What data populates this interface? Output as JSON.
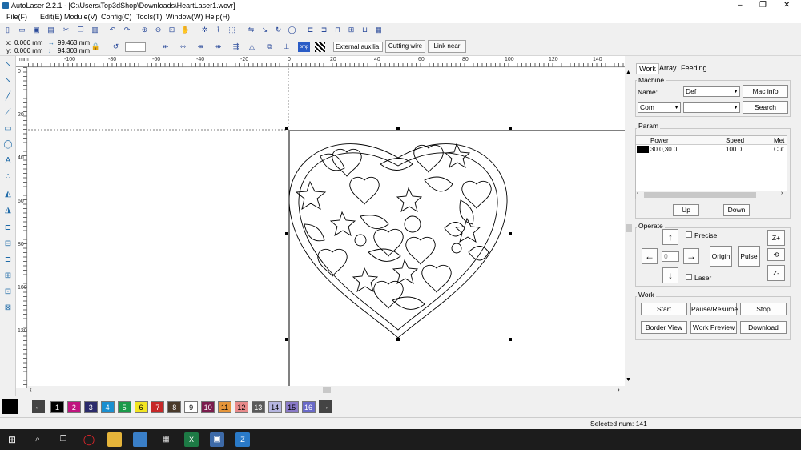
{
  "window": {
    "title": "AutoLaser 2.2.1 - [C:\\Users\\Top3dShop\\Downloads\\HeartLaser1.wcvr]",
    "minimize": "–",
    "maximize": "❐",
    "close": "✕"
  },
  "menu": [
    "File(F)",
    "Edit(E)",
    "Module(V)",
    "Config(C)",
    "Tools(T)",
    "Window(W)",
    "Help(H)"
  ],
  "toolbar2": {
    "x_label": "x:",
    "x_value": "0.000 mm",
    "y_label": "y:",
    "y_value": "0.000 mm",
    "w_value": "99.463 mm",
    "h_value": "94.303 mm",
    "select_value": "External auxilia",
    "cutting_wire": "Cutting wire",
    "link_near": "Link near"
  },
  "ruler": {
    "h_labels": [
      "-100",
      "-80",
      "-60",
      "-40",
      "-20",
      "0",
      "20",
      "40",
      "60",
      "80",
      "100",
      "120",
      "140"
    ],
    "v_labels": [
      "0",
      "20",
      "40",
      "60",
      "80",
      "100",
      "120"
    ],
    "unit": "mm"
  },
  "panel": {
    "tabs": [
      "Work",
      "Array",
      "Feeding"
    ],
    "machine_label": "Machine",
    "name_label": "Name:",
    "name_value": "Def",
    "mac_info": "Mac info",
    "com_value": "Com",
    "port_value": "",
    "search": "Search",
    "param_label": "Param",
    "param_headers": [
      "Power",
      "Speed",
      "Met"
    ],
    "param_row": {
      "power": "30.0,30.0",
      "speed": "100.0",
      "method": "Cut"
    },
    "up": "Up",
    "down": "Down",
    "operate_label": "Operate",
    "precise": "Precise",
    "laser": "Laser",
    "step_value": "0",
    "origin": "Origin",
    "pulse": "Pulse",
    "z_plus": "Z+",
    "z_minus": "Z-",
    "work_label": "Work",
    "start": "Start",
    "pause_resume": "Pause/Resume",
    "stop": "Stop",
    "border_view": "Border View",
    "work_preview": "Work Preview",
    "download": "Download"
  },
  "layers": [
    {
      "label": "1",
      "color": "#000000",
      "text": "#ffffff"
    },
    {
      "label": "2",
      "color": "#c0157f",
      "text": "#ffffff"
    },
    {
      "label": "3",
      "color": "#2b2b6b",
      "text": "#ffffff"
    },
    {
      "label": "4",
      "color": "#1a8fd0",
      "text": "#ffffff"
    },
    {
      "label": "5",
      "color": "#1b9a4a",
      "text": "#ffffff"
    },
    {
      "label": "6",
      "color": "#f2e521",
      "text": "#000000"
    },
    {
      "label": "7",
      "color": "#c62828",
      "text": "#ffffff"
    },
    {
      "label": "8",
      "color": "#4a3a2a",
      "text": "#ffffff"
    },
    {
      "label": "9",
      "color": "#ffffff",
      "text": "#000000"
    },
    {
      "label": "10",
      "color": "#7a1c4d",
      "text": "#ffffff"
    },
    {
      "label": "11",
      "color": "#e5953a",
      "text": "#000000"
    },
    {
      "label": "12",
      "color": "#e88a8a",
      "text": "#000000"
    },
    {
      "label": "13",
      "color": "#5a5a5a",
      "text": "#ffffff"
    },
    {
      "label": "14",
      "color": "#b6b6e0",
      "text": "#000000"
    },
    {
      "label": "15",
      "color": "#8a7ac8",
      "text": "#000000"
    },
    {
      "label": "16",
      "color": "#6a6ac8",
      "text": "#ffffff"
    }
  ],
  "status": {
    "selected": "Selected num: 141"
  },
  "colors": {
    "accent": "#1e6aa8",
    "taskbar": "#1c1c1c"
  }
}
